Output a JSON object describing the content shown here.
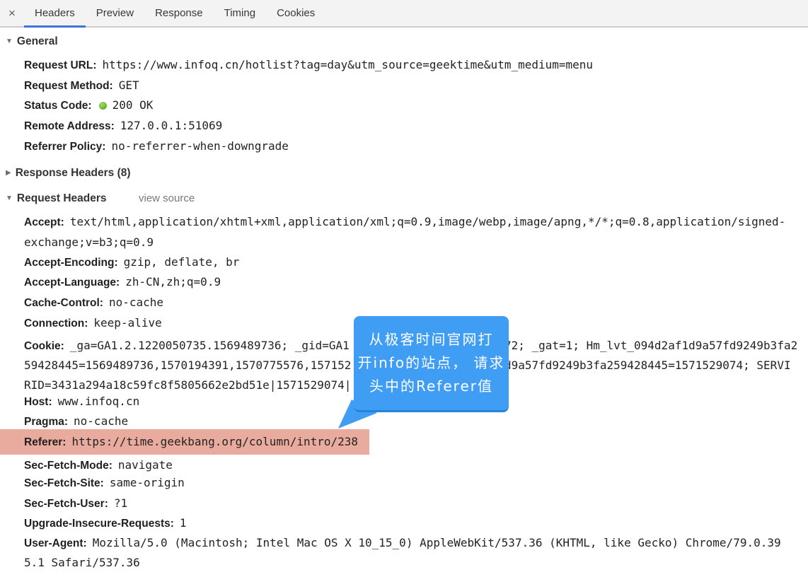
{
  "colors": {
    "accent_blue": "#3e74d9",
    "callout_blue": "#3f9ef3",
    "highlight_salmon": "#eaab9f",
    "status_green": "#5aa822"
  },
  "icons": {
    "close": "×",
    "expanded": "▼",
    "collapsed": "▶"
  },
  "tabbar": {
    "tabs": [
      "Headers",
      "Preview",
      "Response",
      "Timing",
      "Cookies"
    ],
    "active_tab": "Headers"
  },
  "general": {
    "title": "General",
    "rows": [
      {
        "label": "Request URL:",
        "value": "https://www.infoq.cn/hotlist?tag=day&utm_source=geektime&utm_medium=menu"
      },
      {
        "label": "Request Method:",
        "value": "GET"
      },
      {
        "label": "Status Code:",
        "value": "200 OK"
      },
      {
        "label": "Remote Address:",
        "value": "127.0.0.1:51069"
      },
      {
        "label": "Referrer Policy:",
        "value": "no-referrer-when-downgrade"
      }
    ]
  },
  "response_headers": {
    "title": "Response Headers (8)"
  },
  "request_headers": {
    "title": "Request Headers",
    "view_source": "view source",
    "lines": [
      {
        "label": "Accept:",
        "value": "text/html,application/xhtml+xml,application/xml;q=0.9,image/webp,image/apng,*/*;q=0.8,application/signed-"
      },
      {
        "value": "exchange;v=b3;q=0.9"
      },
      {
        "label": "Accept-Encoding:",
        "value": "gzip, deflate, br"
      },
      {
        "label": "Accept-Language:",
        "value": "zh-CN,zh;q=0.9"
      },
      {
        "label": "Cache-Control:",
        "value": "no-cache"
      },
      {
        "label": "Connection:",
        "value": "keep-alive"
      },
      {
        "label": "Cookie:",
        "left": "_ga=GA1.2.1220050735.1569489736; _gid=GA1",
        "right": "72; _gat=1; Hm_lvt_094d2af1d9a57fd9249b3fa2"
      },
      {
        "left": "59428445=1569489736,1570194391,1570775576,157152",
        "right": "d9a57fd9249b3fa259428445=1571529074; SERVI"
      },
      {
        "left": "RID=3431a294a18c59fc8f5805662e2bd51e|1571529074|"
      },
      {
        "label": "Host:",
        "value": "www.infoq.cn"
      },
      {
        "label": "Pragma:",
        "value": "no-cache"
      },
      {
        "label": "Referer:",
        "value": "https://time.geekbang.org/column/intro/238",
        "highlighted": true
      },
      {
        "label": "Sec-Fetch-Mode:",
        "value": "navigate"
      },
      {
        "label": "Sec-Fetch-Site:",
        "value": "same-origin"
      },
      {
        "label": "Sec-Fetch-User:",
        "value": "?1"
      },
      {
        "label": "Upgrade-Insecure-Requests:",
        "value": "1"
      },
      {
        "label": "User-Agent:",
        "value": "Mozilla/5.0 (Macintosh; Intel Mac OS X 10_15_0) AppleWebKit/537.36 (KHTML, like Gecko) Chrome/79.0.39"
      },
      {
        "value": "5.1 Safari/537.36"
      }
    ]
  },
  "callout": {
    "line1": "从极客时间官网打",
    "line2": "开info的站点， 请求",
    "line3": "头中的Referer值"
  }
}
